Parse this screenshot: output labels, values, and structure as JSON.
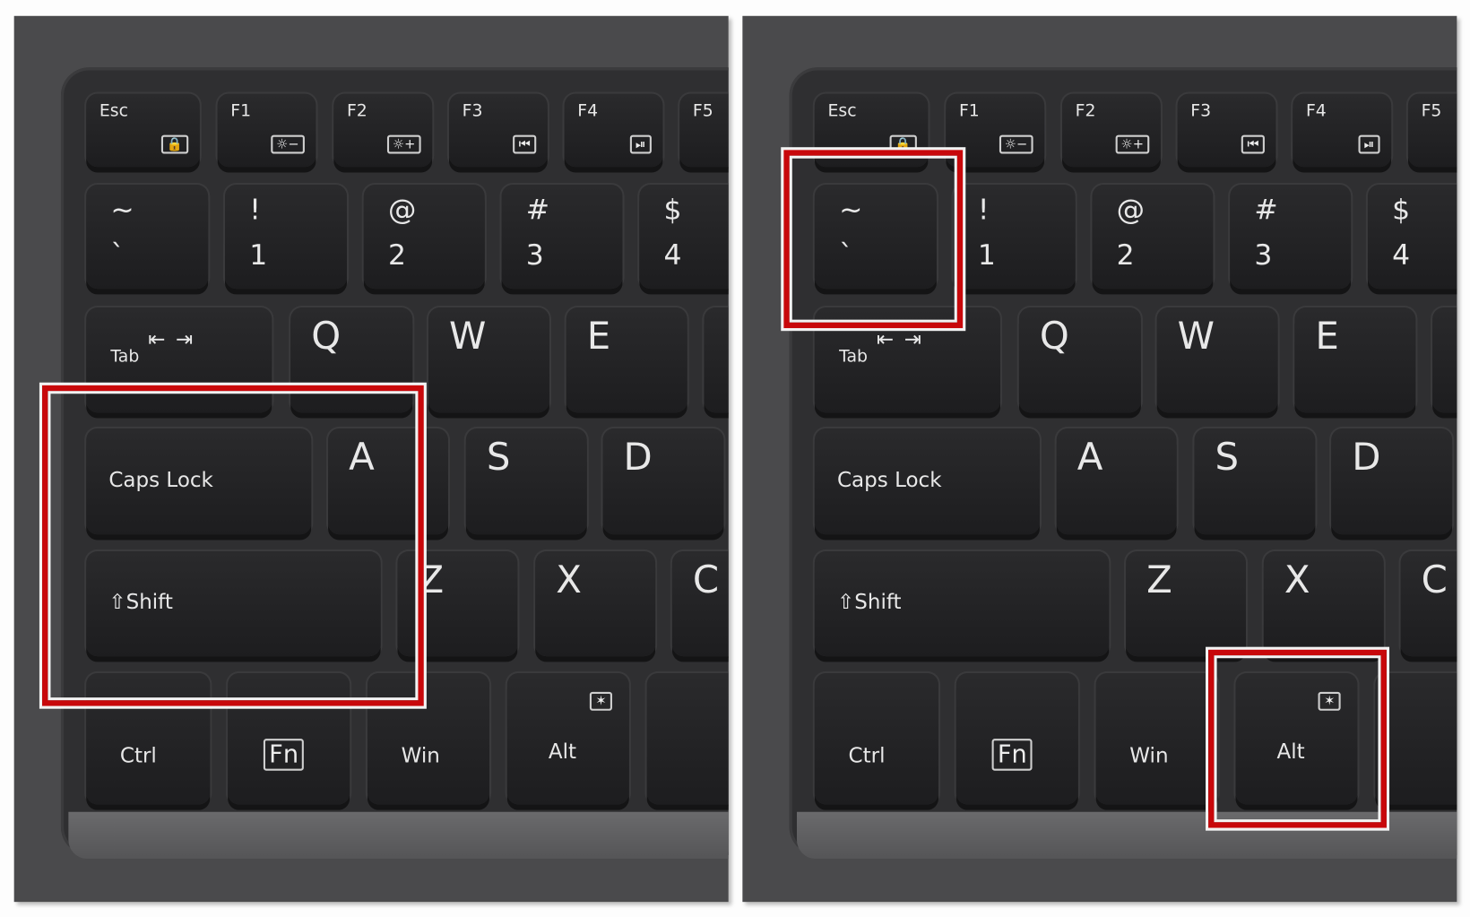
{
  "panels": [
    {
      "id": "left"
    },
    {
      "id": "right"
    }
  ],
  "keys": [
    {
      "id": "esc",
      "top": "Esc",
      "icon": "lock-icon",
      "glyph": "🔒"
    },
    {
      "id": "f1",
      "top": "F1",
      "icon": "brightness-down-icon",
      "glyph": "☼−"
    },
    {
      "id": "f2",
      "top": "F2",
      "icon": "brightness-up-icon",
      "glyph": "☼+"
    },
    {
      "id": "f3",
      "top": "F3",
      "icon": "previous-track-icon",
      "glyph": "⏮"
    },
    {
      "id": "f4",
      "top": "F4",
      "icon": "play-pause-icon",
      "glyph": "⏯"
    },
    {
      "id": "f5",
      "top": "F5"
    },
    {
      "id": "tilde",
      "top": "~",
      "bottom": "`"
    },
    {
      "id": "1",
      "top": "!",
      "bottom": "1"
    },
    {
      "id": "2",
      "top": "@",
      "bottom": "2"
    },
    {
      "id": "3",
      "top": "#",
      "bottom": "3"
    },
    {
      "id": "4",
      "top": "$",
      "bottom": "4"
    },
    {
      "id": "tab",
      "top": "Tab",
      "glyph": "⇤ ⇥",
      "icon": "tab-arrows-icon"
    },
    {
      "id": "q",
      "top": "Q"
    },
    {
      "id": "w",
      "top": "W"
    },
    {
      "id": "e",
      "top": "E"
    },
    {
      "id": "r",
      "top": ""
    },
    {
      "id": "capslock",
      "top": "Caps Lock"
    },
    {
      "id": "a",
      "top": "A"
    },
    {
      "id": "s",
      "top": "S"
    },
    {
      "id": "d",
      "top": "D"
    },
    {
      "id": "shift",
      "top": "⇧Shift",
      "icon": "shift-arrow-icon"
    },
    {
      "id": "z",
      "top": "Z"
    },
    {
      "id": "x",
      "top": "X"
    },
    {
      "id": "c",
      "top": "C"
    },
    {
      "id": "ctrl",
      "top": "Ctrl"
    },
    {
      "id": "fn",
      "top": "Fn"
    },
    {
      "id": "win",
      "top": "Win"
    },
    {
      "id": "alt",
      "top": "Alt",
      "icon": "backlight-icon",
      "glyph": "✶"
    },
    {
      "id": "next",
      "top": ""
    }
  ],
  "highlights": {
    "left": [
      "capslock-shift-area"
    ],
    "right": [
      "tilde-key",
      "alt-key"
    ]
  },
  "colors": {
    "highlight": "#c8080b",
    "key": "#1f1f21",
    "body": "#4a4a4c"
  }
}
